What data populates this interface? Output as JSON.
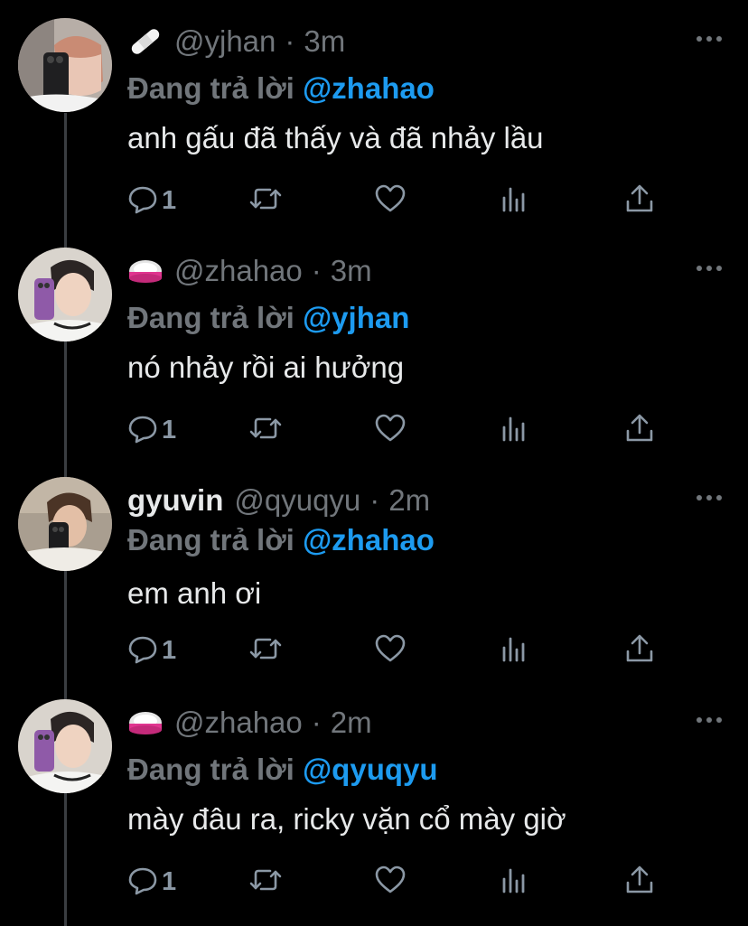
{
  "colors": {
    "background": "#000000",
    "text": "#e7e9ea",
    "muted": "#71767b",
    "mention": "#1d9bf0",
    "icon": "#8b98a5"
  },
  "tweets": [
    {
      "display_name": "",
      "handle": "@yjhan",
      "dot": "·",
      "time": "3m",
      "emoji": "bandage",
      "reply_prefix": "Đang trả lời",
      "reply_to": "@zhahao",
      "text": "anh gấu đã thấy và đã nhảy lầu",
      "reply_count": "1"
    },
    {
      "display_name": "",
      "handle": "@zhahao",
      "dot": "·",
      "time": "3m",
      "emoji": "pink-ring",
      "reply_prefix": "Đang trả lời",
      "reply_to": "@yjhan",
      "text": "nó nhảy rồi ai hưởng",
      "reply_count": "1"
    },
    {
      "display_name": "gyuvin",
      "handle": "@qyuqyu",
      "dot": "·",
      "time": "2m",
      "emoji": "",
      "reply_prefix": "Đang trả lời",
      "reply_to": "@zhahao",
      "text": "em anh ơi",
      "reply_count": "1"
    },
    {
      "display_name": "",
      "handle": "@zhahao",
      "dot": "·",
      "time": "2m",
      "emoji": "pink-ring",
      "reply_prefix": "Đang trả lời",
      "reply_to": "@qyuqyu",
      "text": "mày đâu ra, ricky vặn cổ mày giờ",
      "reply_count": "1"
    }
  ]
}
